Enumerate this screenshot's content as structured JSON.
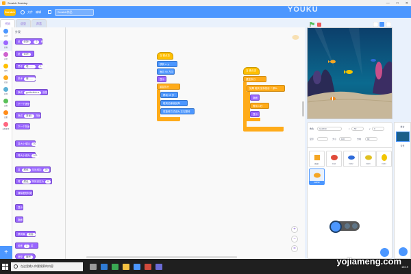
{
  "window": {
    "title": "Scratch Desktop",
    "min": "—",
    "max": "□",
    "close": "✕"
  },
  "menubar": {
    "logo": "Scratch",
    "file_menu": "文件",
    "edit_menu": "编辑",
    "project_title": "Scratch作品"
  },
  "watermark_top": "YOUKU",
  "watermark_bottom": "yojiameng.com",
  "tabs": [
    {
      "label": "代码"
    },
    {
      "label": "造型"
    },
    {
      "label": "声音"
    }
  ],
  "categories": [
    {
      "label": "运动",
      "color": "#4c97ff"
    },
    {
      "label": "外观",
      "color": "#9966ff"
    },
    {
      "label": "声音",
      "color": "#cf63cf"
    },
    {
      "label": "事件",
      "color": "#ffbf00"
    },
    {
      "label": "控制",
      "color": "#ffab19"
    },
    {
      "label": "侦测",
      "color": "#5cb1d6"
    },
    {
      "label": "运算",
      "color": "#59c059"
    },
    {
      "label": "变量",
      "color": "#ff8c1a"
    },
    {
      "label": "自制积木",
      "color": "#ff6680"
    }
  ],
  "palette": {
    "heading": "外观",
    "blocks": [
      {
        "text": "说",
        "arg": "你好!",
        "arg2": "2",
        "suffix": "秒"
      },
      {
        "text": "说",
        "arg": "你好!"
      },
      {
        "text": "思考",
        "arg": "嗯……",
        "arg2": "2",
        "suffix": "秒"
      },
      {
        "text": "思考",
        "arg": "嗯……"
      },
      {
        "text": "换成",
        "arg": "goldenfish-a",
        "suffix": "造型"
      },
      {
        "text": "下一个造型"
      },
      {
        "text": "换成",
        "arg": "背景1",
        "suffix": "背景"
      },
      {
        "text": "下一个背景"
      },
      {
        "text": "将大小增加",
        "arg": "10"
      },
      {
        "text": "将大小设为",
        "arg": "100"
      },
      {
        "text": "将",
        "arg": "颜色",
        "suffix": "特效增加",
        "arg2": "25"
      },
      {
        "text": "将",
        "arg": "颜色",
        "suffix": "特效设定为",
        "arg2": "0"
      },
      {
        "text": "清除图形特效"
      },
      {
        "text": "显示"
      },
      {
        "text": "隐藏"
      },
      {
        "text": "移到最",
        "arg": "前面"
      },
      {
        "text": "前移",
        "arg": "1",
        "suffix": "层"
      },
      {
        "text": "造型",
        "arg": "编号"
      }
    ]
  },
  "script1": {
    "hat": "当 被点击",
    "blocks": [
      "移到 x: y:",
      "面向 90 方向",
      "显示",
      "重复执行",
      "移动 10 步",
      "碰到边缘就反弹",
      "将旋转方式设为 左右翻转"
    ]
  },
  "script2": {
    "hat": "当 被点击",
    "blocks": [
      "重复执行",
      "如果 碰到 鼠标指针 ? 那么",
      "隐藏",
      "等待 1 秒",
      "显示"
    ]
  },
  "stage": {
    "colors": {
      "water": "#0b5a86",
      "sand": "#c7b79a"
    }
  },
  "sprite_info": {
    "sprite_label": "角色",
    "sprite_name": "Goldfish",
    "x_label": "x",
    "x_value": "-50",
    "y_label": "y",
    "y_value": "0",
    "show_label": "显示",
    "size_label": "大小",
    "size_value": "100",
    "direction_label": "方向",
    "direction_value": "90"
  },
  "sprites": [
    {
      "name": "角色1",
      "color": "#f5a623"
    },
    {
      "name": "Crab",
      "color": "#e8ae4e"
    },
    {
      "name": "Fish2",
      "color": "#2e6bd9"
    },
    {
      "name": "Fish3",
      "color": "#e0c020"
    },
    {
      "name": "Fish4",
      "color": "#f2c500"
    },
    {
      "name": "Goldfish",
      "color": "#f5a623"
    }
  ],
  "stage_pane": {
    "label": "舞台",
    "backdrops_label": "背景"
  },
  "taskbar": {
    "search_placeholder": "在这里输入你要搜索的内容",
    "time": "16:19"
  }
}
